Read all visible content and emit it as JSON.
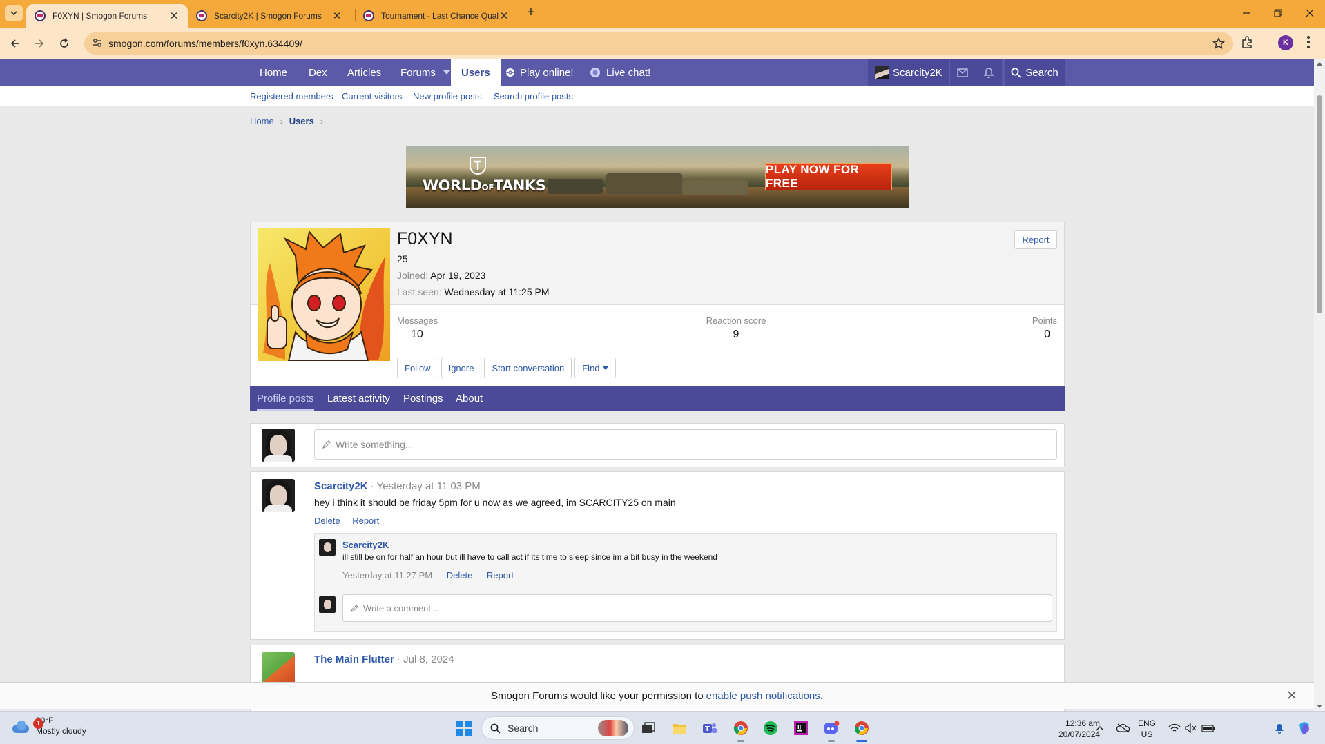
{
  "browser": {
    "tabs": [
      {
        "title": "F0XYN | Smogon Forums",
        "active": true
      },
      {
        "title": "Scarcity2K | Smogon Forums",
        "active": false
      },
      {
        "title": "Tournament - Last Chance Qual",
        "active": false
      }
    ],
    "url": "smogon.com/forums/members/f0xyn.634409/",
    "profile_initial": "K"
  },
  "site_nav": {
    "items": [
      "Home",
      "Dex",
      "Articles",
      "Forums",
      "Users",
      "Play online!",
      "Live chat!"
    ],
    "active": "Users",
    "user_name": "Scarcity2K",
    "search_label": "Search"
  },
  "sub_nav": [
    "Registered members",
    "Current visitors",
    "New profile posts",
    "Search profile posts"
  ],
  "breadcrumb": {
    "home": "Home",
    "current": "Users"
  },
  "banner": {
    "logo_text_1": "WORLD",
    "logo_text_of": "OF",
    "logo_text_2": "TANKS",
    "cta": "PLAY NOW FOR FREE"
  },
  "profile": {
    "username": "F0XYN",
    "user_title": "25",
    "joined_label": "Joined:",
    "joined_value": "Apr 19, 2023",
    "last_seen_label": "Last seen:",
    "last_seen_value": "Wednesday at 11:25 PM",
    "report_label": "Report",
    "stats": [
      {
        "label": "Messages",
        "value": "10"
      },
      {
        "label": "Reaction score",
        "value": "9"
      },
      {
        "label": "Points",
        "value": "0"
      }
    ],
    "actions": [
      "Follow",
      "Ignore",
      "Start conversation",
      "Find"
    ]
  },
  "profile_tabs": [
    "Profile posts",
    "Latest activity",
    "Postings",
    "About"
  ],
  "write_placeholder": "Write something...",
  "posts": [
    {
      "author": "Scarcity2K",
      "time": "· Yesterday at 11:03 PM",
      "body": "hey i think it should be friday 5pm for u now as we agreed, im SCARCITY25 on main",
      "actions": [
        "Delete",
        "Report"
      ],
      "comment": {
        "author": "Scarcity2K",
        "text": "ill still be on for half an hour but ill have to call act if its time to sleep since im a bit busy in the weekend",
        "time": "Yesterday at 11:27 PM",
        "actions": [
          "Delete",
          "Report"
        ]
      },
      "comment_placeholder": "Write a comment..."
    },
    {
      "author": "The Main Flutter",
      "time": "· Jul 8, 2024"
    }
  ],
  "push_bar": {
    "text": "Smogon Forums would like your permission to",
    "link": "enable push notifications."
  },
  "taskbar": {
    "weather_temp": "80°F",
    "weather_desc": "Mostly cloudy",
    "weather_badge": "1",
    "search_label": "Search",
    "lang_1": "ENG",
    "lang_2": "US",
    "time": "12:36 am",
    "date": "20/07/2024"
  },
  "colors": {
    "tabstrip": "#f4a93a",
    "site_nav": "#5a5aa9",
    "link": "#2e58a8"
  }
}
